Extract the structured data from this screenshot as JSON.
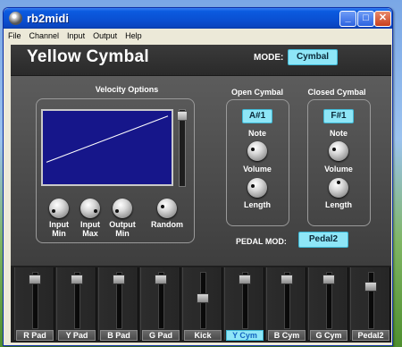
{
  "window": {
    "title": "rb2midi",
    "minimize_glyph": "_",
    "maximize_glyph": "□",
    "close_glyph": "✕"
  },
  "menu": [
    "File",
    "Channel",
    "Input",
    "Output",
    "Help"
  ],
  "header": {
    "instrument": "Yellow Cymbal",
    "mode_label": "MODE:",
    "mode_value": "Cymbal"
  },
  "velocity": {
    "title": "Velocity Options",
    "curve": {
      "start": [
        0,
        0.3
      ],
      "end": [
        1,
        0.93
      ]
    },
    "slider_level": 0.98,
    "knobs": [
      "Input\nMin",
      "Input\nMax",
      "Output\nMin",
      "Random"
    ]
  },
  "open_cymbal": {
    "title": "Open Cymbal",
    "note": "A#1",
    "note_label": "Note",
    "volume_label": "Volume",
    "length_label": "Length"
  },
  "closed_cymbal": {
    "title": "Closed Cymbal",
    "note": "F#1",
    "note_label": "Note",
    "volume_label": "Volume",
    "length_label": "Length"
  },
  "pedal_mod": {
    "label": "PEDAL MOD:",
    "value": "Pedal2"
  },
  "channels": [
    {
      "label": "R Pad",
      "level": 0.95,
      "active": false
    },
    {
      "label": "Y Pad",
      "level": 0.95,
      "active": false
    },
    {
      "label": "B Pad",
      "level": 0.95,
      "active": false
    },
    {
      "label": "G Pad",
      "level": 0.95,
      "active": false
    },
    {
      "label": "Kick",
      "level": 0.55,
      "active": false
    },
    {
      "label": "Y Cym",
      "level": 0.95,
      "active": true
    },
    {
      "label": "B Cym",
      "level": 0.95,
      "active": false
    },
    {
      "label": "G Cym",
      "level": 0.95,
      "active": false
    },
    {
      "label": "Pedal2",
      "level": 0.8,
      "active": false
    }
  ],
  "colors": {
    "accent": "#8ee6f7",
    "graph_bg": "#16168a",
    "active_text": "#1465c0"
  }
}
